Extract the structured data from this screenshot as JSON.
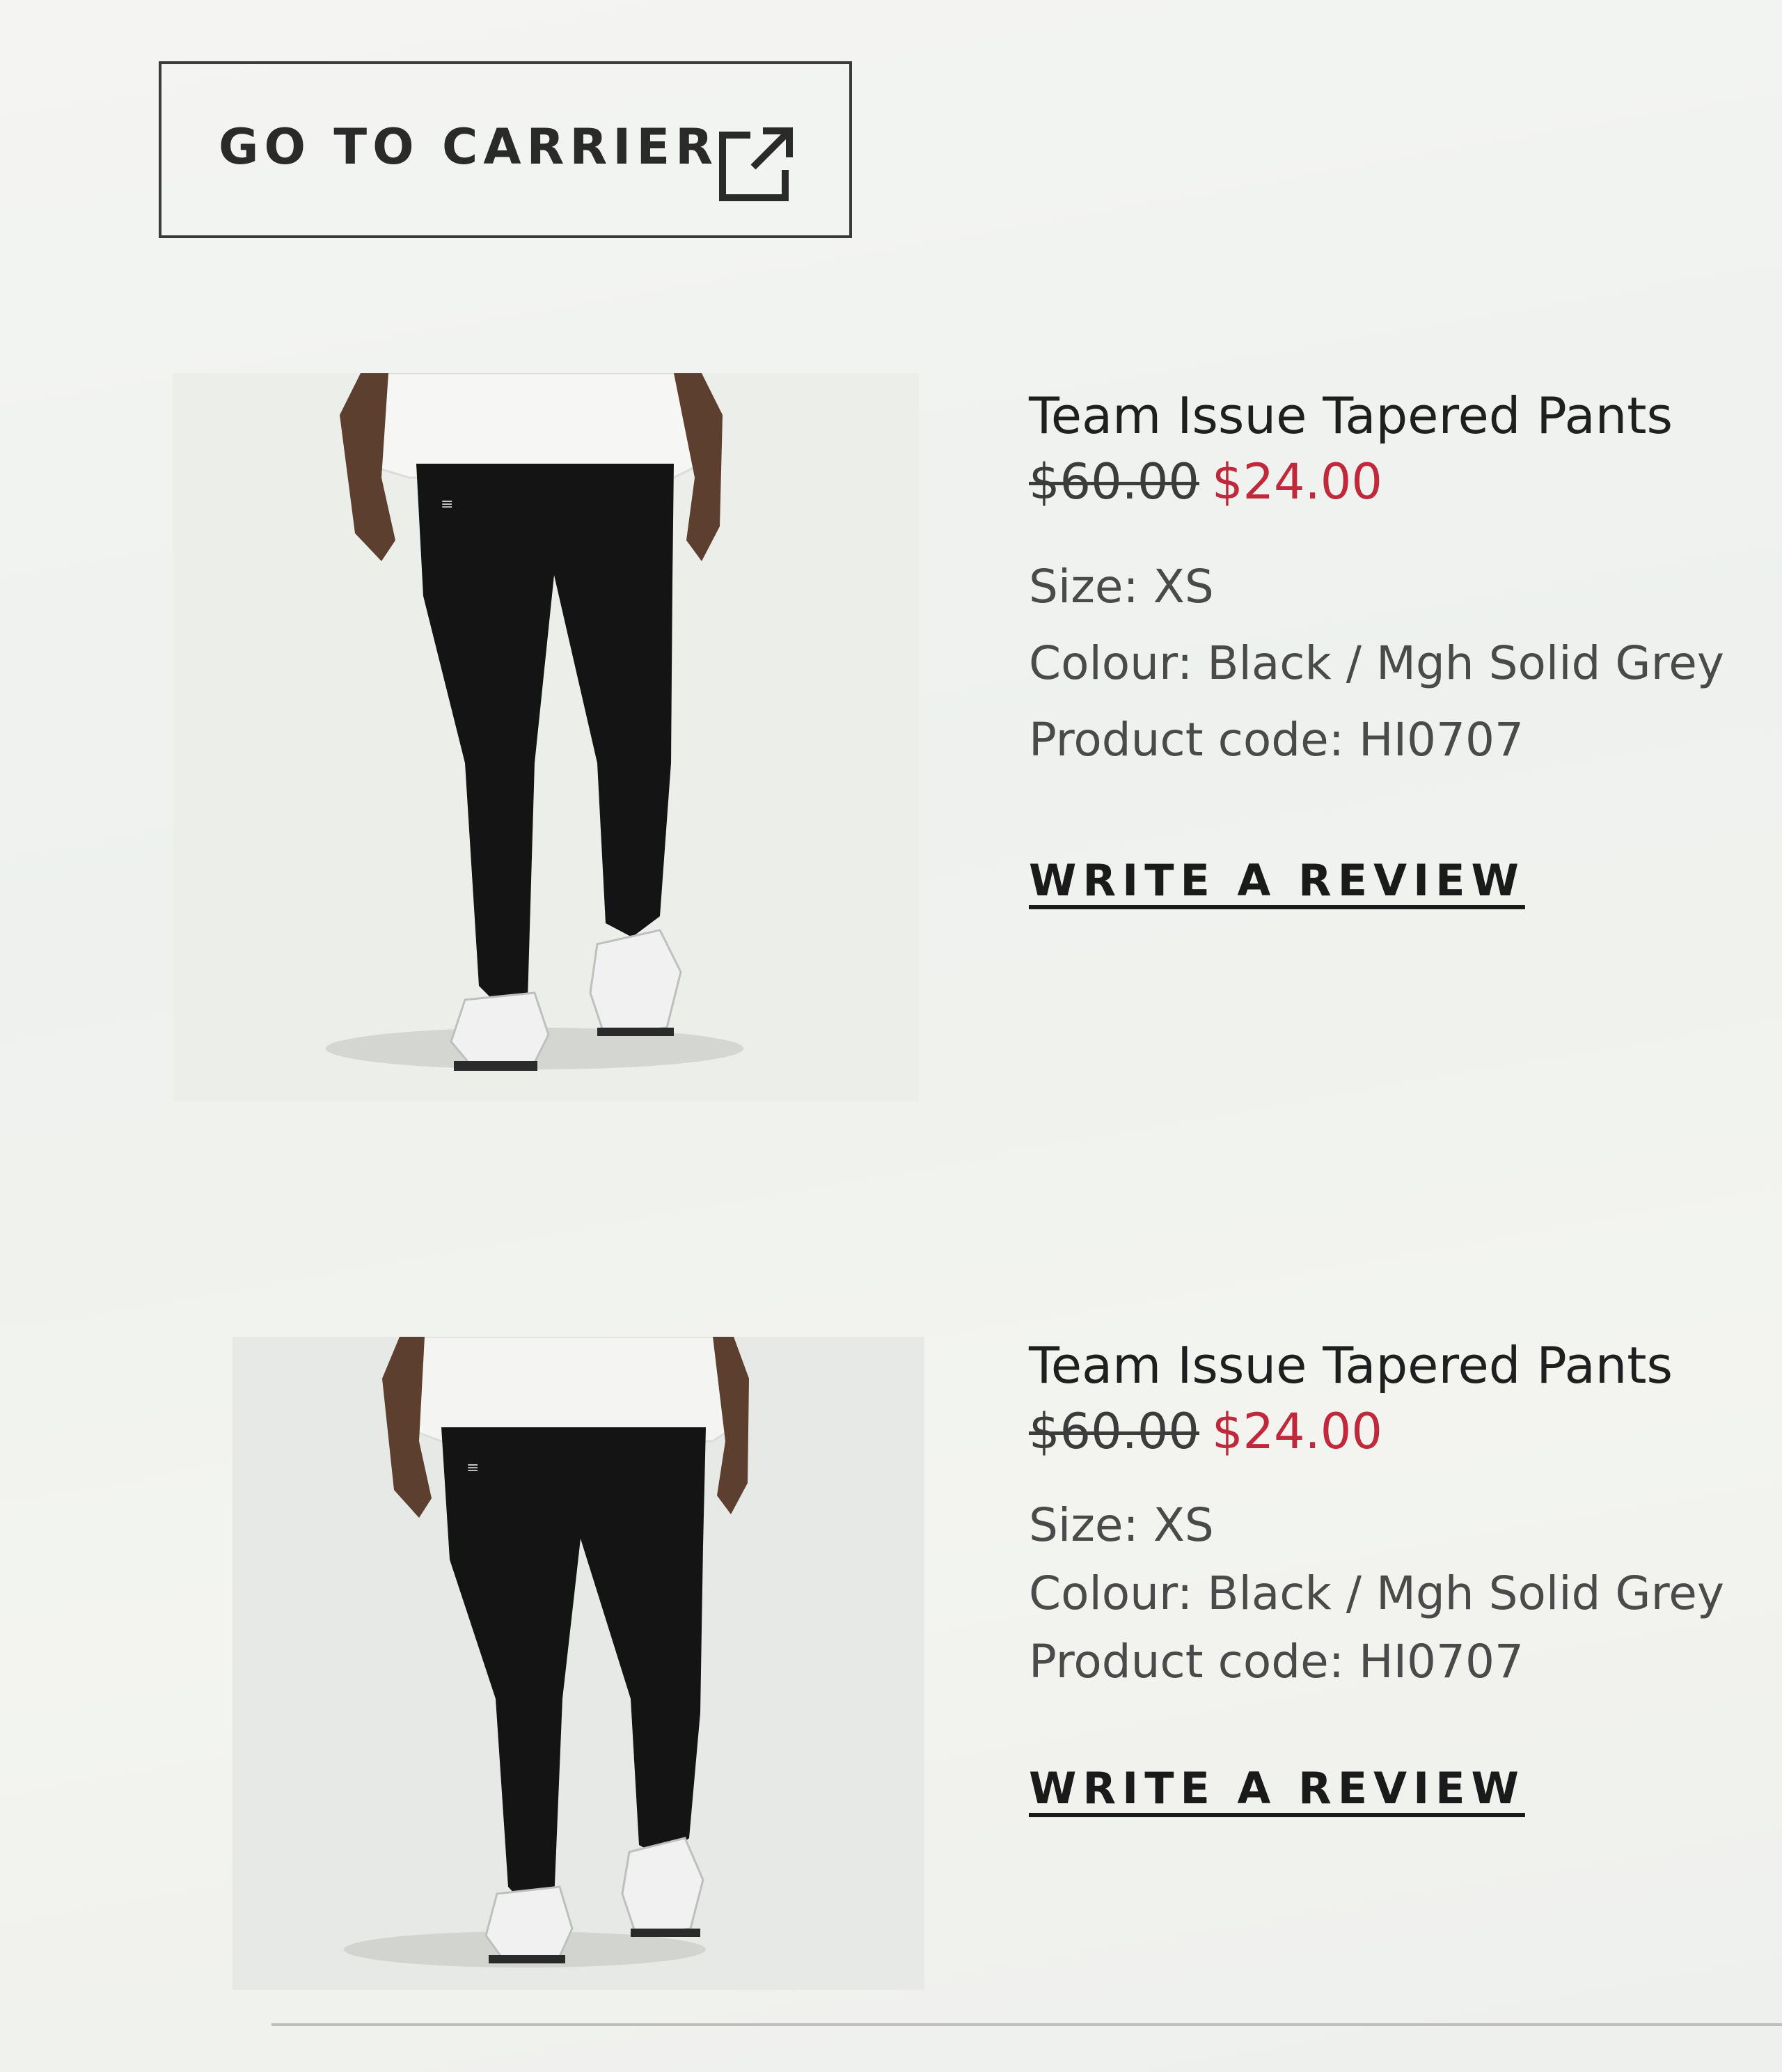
{
  "carrier": {
    "label": "GO TO CARRIER",
    "icon": "external-link-icon"
  },
  "products": [
    {
      "name": "Team Issue Tapered Pants",
      "original_price": "$60.00",
      "sale_price": "$24.00",
      "size": "Size: XS",
      "colour": "Colour: Black / Mgh Solid Grey",
      "product_code": "Product code: HI0707",
      "review_label": "WRITE A REVIEW"
    },
    {
      "name": "Team Issue Tapered Pants",
      "original_price": "$60.00",
      "sale_price": "$24.00",
      "size": "Size: XS",
      "colour": "Colour: Black / Mgh Solid Grey",
      "product_code": "Product code: HI0707",
      "review_label": "WRITE A REVIEW"
    }
  ],
  "colors": {
    "sale": "#c0283b",
    "text": "#1f1f1f",
    "border": "#3a3a3a"
  }
}
